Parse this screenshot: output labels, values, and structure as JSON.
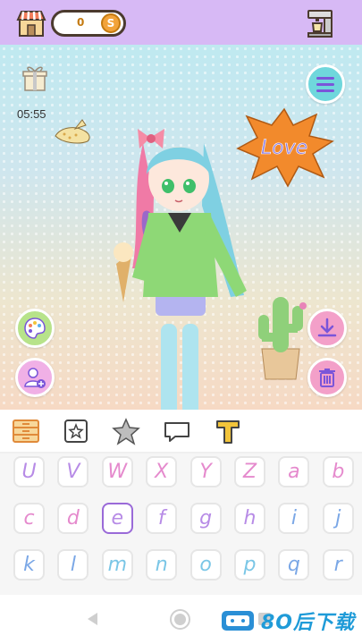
{
  "header": {
    "coin_count": "0",
    "coin_symbol": "S"
  },
  "stage": {
    "timer": "05:55",
    "sticker_text": "Love"
  },
  "tabs": [
    {
      "name": "furniture",
      "icon": "dresser-icon",
      "selected": true
    },
    {
      "name": "frame",
      "icon": "star-frame-icon"
    },
    {
      "name": "stickers",
      "icon": "star-icon"
    },
    {
      "name": "speech",
      "icon": "speech-bubble-icon"
    },
    {
      "name": "text",
      "icon": "text-t-icon"
    }
  ],
  "letters": [
    {
      "ch": "U",
      "color": "#b78be6"
    },
    {
      "ch": "V",
      "color": "#b78be6"
    },
    {
      "ch": "W",
      "color": "#e58acd"
    },
    {
      "ch": "X",
      "color": "#e58acd"
    },
    {
      "ch": "Y",
      "color": "#e58acd"
    },
    {
      "ch": "Z",
      "color": "#e58acd"
    },
    {
      "ch": "a",
      "color": "#e58acd"
    },
    {
      "ch": "b",
      "color": "#e58acd"
    },
    {
      "ch": "c",
      "color": "#e58acd"
    },
    {
      "ch": "d",
      "color": "#e58acd"
    },
    {
      "ch": "e",
      "color": "#b78be6",
      "selected": true
    },
    {
      "ch": "f",
      "color": "#b78be6"
    },
    {
      "ch": "g",
      "color": "#b78be6"
    },
    {
      "ch": "h",
      "color": "#b78be6"
    },
    {
      "ch": "i",
      "color": "#7aa7e6"
    },
    {
      "ch": "j",
      "color": "#7aa7e6"
    },
    {
      "ch": "k",
      "color": "#7aa7e6"
    },
    {
      "ch": "l",
      "color": "#7aa7e6"
    },
    {
      "ch": "m",
      "color": "#7ac6e6"
    },
    {
      "ch": "n",
      "color": "#7ac6e6"
    },
    {
      "ch": "o",
      "color": "#7ac6e6"
    },
    {
      "ch": "p",
      "color": "#7ac6e6"
    },
    {
      "ch": "q",
      "color": "#7aa7e6"
    },
    {
      "ch": "r",
      "color": "#7aa7e6"
    }
  ],
  "watermark": {
    "text": "8O后下载"
  },
  "colors": {
    "topbar": "#d7b9f5",
    "menu_button": "#6fd7dc",
    "accent_purple": "#7a55d9",
    "pink_button": "#f3a0c9",
    "sticker_orange": "#f28a2c"
  }
}
